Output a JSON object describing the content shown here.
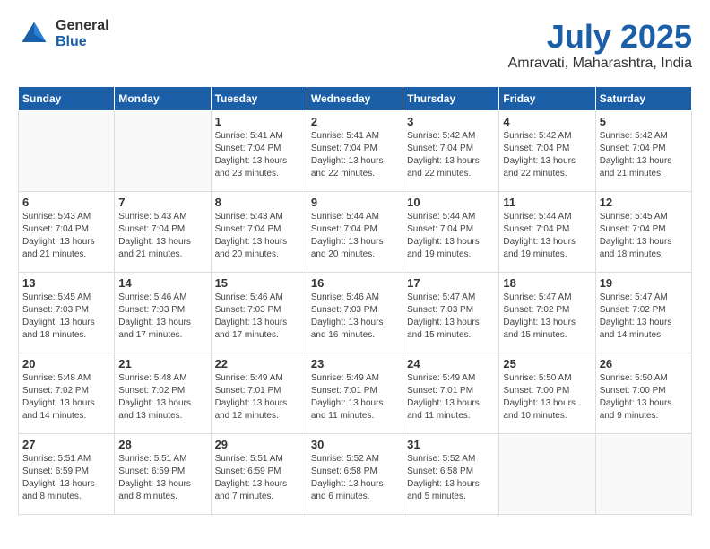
{
  "logo": {
    "general": "General",
    "blue": "Blue"
  },
  "title": {
    "month_year": "July 2025",
    "location": "Amravati, Maharashtra, India"
  },
  "days_of_week": [
    "Sunday",
    "Monday",
    "Tuesday",
    "Wednesday",
    "Thursday",
    "Friday",
    "Saturday"
  ],
  "weeks": [
    [
      {
        "day": "",
        "info": ""
      },
      {
        "day": "",
        "info": ""
      },
      {
        "day": "1",
        "info": "Sunrise: 5:41 AM\nSunset: 7:04 PM\nDaylight: 13 hours\nand 23 minutes."
      },
      {
        "day": "2",
        "info": "Sunrise: 5:41 AM\nSunset: 7:04 PM\nDaylight: 13 hours\nand 22 minutes."
      },
      {
        "day": "3",
        "info": "Sunrise: 5:42 AM\nSunset: 7:04 PM\nDaylight: 13 hours\nand 22 minutes."
      },
      {
        "day": "4",
        "info": "Sunrise: 5:42 AM\nSunset: 7:04 PM\nDaylight: 13 hours\nand 22 minutes."
      },
      {
        "day": "5",
        "info": "Sunrise: 5:42 AM\nSunset: 7:04 PM\nDaylight: 13 hours\nand 21 minutes."
      }
    ],
    [
      {
        "day": "6",
        "info": "Sunrise: 5:43 AM\nSunset: 7:04 PM\nDaylight: 13 hours\nand 21 minutes."
      },
      {
        "day": "7",
        "info": "Sunrise: 5:43 AM\nSunset: 7:04 PM\nDaylight: 13 hours\nand 21 minutes."
      },
      {
        "day": "8",
        "info": "Sunrise: 5:43 AM\nSunset: 7:04 PM\nDaylight: 13 hours\nand 20 minutes."
      },
      {
        "day": "9",
        "info": "Sunrise: 5:44 AM\nSunset: 7:04 PM\nDaylight: 13 hours\nand 20 minutes."
      },
      {
        "day": "10",
        "info": "Sunrise: 5:44 AM\nSunset: 7:04 PM\nDaylight: 13 hours\nand 19 minutes."
      },
      {
        "day": "11",
        "info": "Sunrise: 5:44 AM\nSunset: 7:04 PM\nDaylight: 13 hours\nand 19 minutes."
      },
      {
        "day": "12",
        "info": "Sunrise: 5:45 AM\nSunset: 7:04 PM\nDaylight: 13 hours\nand 18 minutes."
      }
    ],
    [
      {
        "day": "13",
        "info": "Sunrise: 5:45 AM\nSunset: 7:03 PM\nDaylight: 13 hours\nand 18 minutes."
      },
      {
        "day": "14",
        "info": "Sunrise: 5:46 AM\nSunset: 7:03 PM\nDaylight: 13 hours\nand 17 minutes."
      },
      {
        "day": "15",
        "info": "Sunrise: 5:46 AM\nSunset: 7:03 PM\nDaylight: 13 hours\nand 17 minutes."
      },
      {
        "day": "16",
        "info": "Sunrise: 5:46 AM\nSunset: 7:03 PM\nDaylight: 13 hours\nand 16 minutes."
      },
      {
        "day": "17",
        "info": "Sunrise: 5:47 AM\nSunset: 7:03 PM\nDaylight: 13 hours\nand 15 minutes."
      },
      {
        "day": "18",
        "info": "Sunrise: 5:47 AM\nSunset: 7:02 PM\nDaylight: 13 hours\nand 15 minutes."
      },
      {
        "day": "19",
        "info": "Sunrise: 5:47 AM\nSunset: 7:02 PM\nDaylight: 13 hours\nand 14 minutes."
      }
    ],
    [
      {
        "day": "20",
        "info": "Sunrise: 5:48 AM\nSunset: 7:02 PM\nDaylight: 13 hours\nand 14 minutes."
      },
      {
        "day": "21",
        "info": "Sunrise: 5:48 AM\nSunset: 7:02 PM\nDaylight: 13 hours\nand 13 minutes."
      },
      {
        "day": "22",
        "info": "Sunrise: 5:49 AM\nSunset: 7:01 PM\nDaylight: 13 hours\nand 12 minutes."
      },
      {
        "day": "23",
        "info": "Sunrise: 5:49 AM\nSunset: 7:01 PM\nDaylight: 13 hours\nand 11 minutes."
      },
      {
        "day": "24",
        "info": "Sunrise: 5:49 AM\nSunset: 7:01 PM\nDaylight: 13 hours\nand 11 minutes."
      },
      {
        "day": "25",
        "info": "Sunrise: 5:50 AM\nSunset: 7:00 PM\nDaylight: 13 hours\nand 10 minutes."
      },
      {
        "day": "26",
        "info": "Sunrise: 5:50 AM\nSunset: 7:00 PM\nDaylight: 13 hours\nand 9 minutes."
      }
    ],
    [
      {
        "day": "27",
        "info": "Sunrise: 5:51 AM\nSunset: 6:59 PM\nDaylight: 13 hours\nand 8 minutes."
      },
      {
        "day": "28",
        "info": "Sunrise: 5:51 AM\nSunset: 6:59 PM\nDaylight: 13 hours\nand 8 minutes."
      },
      {
        "day": "29",
        "info": "Sunrise: 5:51 AM\nSunset: 6:59 PM\nDaylight: 13 hours\nand 7 minutes."
      },
      {
        "day": "30",
        "info": "Sunrise: 5:52 AM\nSunset: 6:58 PM\nDaylight: 13 hours\nand 6 minutes."
      },
      {
        "day": "31",
        "info": "Sunrise: 5:52 AM\nSunset: 6:58 PM\nDaylight: 13 hours\nand 5 minutes."
      },
      {
        "day": "",
        "info": ""
      },
      {
        "day": "",
        "info": ""
      }
    ]
  ]
}
